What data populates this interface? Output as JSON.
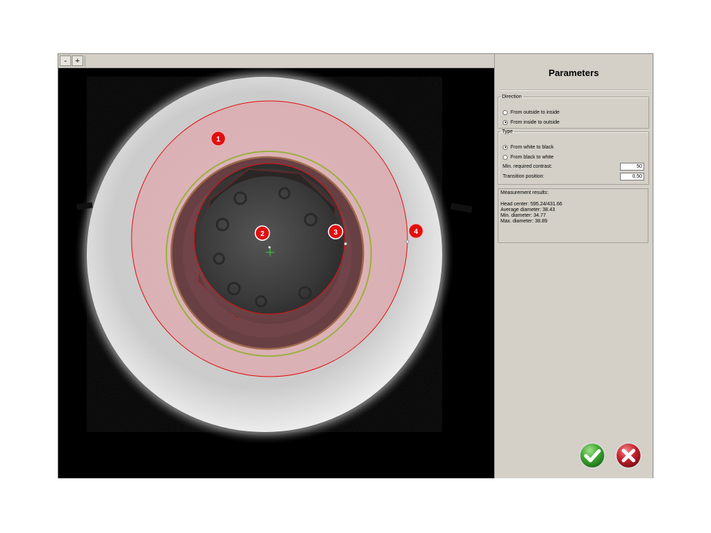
{
  "toolbar": {
    "zoom_out_label": "-",
    "zoom_in_label": "+"
  },
  "markers": [
    {
      "id": "1",
      "label": "1"
    },
    {
      "id": "2",
      "label": "2"
    },
    {
      "id": "3",
      "label": "3"
    },
    {
      "id": "4",
      "label": "4"
    }
  ],
  "panel": {
    "title": "Parameters",
    "direction": {
      "legend": "Direction",
      "options": [
        {
          "label": "From outside to inside",
          "selected": false
        },
        {
          "label": "From inside to outside",
          "selected": true
        }
      ]
    },
    "type": {
      "legend": "Type",
      "options": [
        {
          "label": "From white to black",
          "selected": true
        },
        {
          "label": "From black to white",
          "selected": false
        }
      ],
      "min_contrast_label": "Min. required contrast:",
      "min_contrast_value": "50",
      "transition_label": "Transition position:",
      "transition_value": "0.50"
    },
    "results": {
      "header": "Measurement results:",
      "head_center": "Head center: 595.24/431.66",
      "average_diameter": "Average diameter: 38.43",
      "min_diameter": "Min. diameter: 34.77",
      "max_diameter": "Max. diameter: 38.89"
    }
  },
  "colors": {
    "accent_red": "#e01010",
    "ok_green": "#3fa52f",
    "cancel_red": "#c8202a",
    "panel_bg": "#d4d0c8"
  },
  "icons": {
    "ok": "check-icon",
    "cancel": "close-icon"
  }
}
